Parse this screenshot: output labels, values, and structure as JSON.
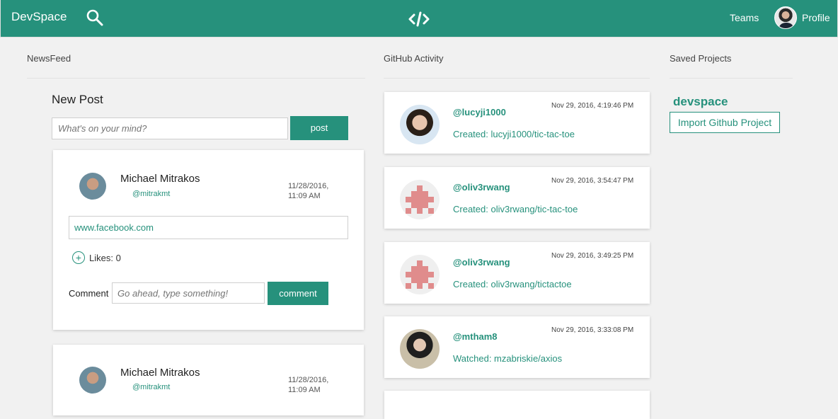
{
  "navbar": {
    "brand": "DevSpace",
    "teams": "Teams",
    "profile": "Profile",
    "icons": [
      "search-icon",
      "code-logo-icon",
      "avatar"
    ]
  },
  "columns": {
    "newsfeed": "NewsFeed",
    "github": "GitHub Activity",
    "saved": "Saved Projects"
  },
  "new_post": {
    "title": "New Post",
    "placeholder": "What's on your mind?",
    "button": "post"
  },
  "posts": [
    {
      "author": "Michael Mitrakos",
      "handle": "@mitrakmt",
      "date": "11/28/2016,",
      "time": "11:09 AM",
      "link": "www.facebook.com",
      "likes": "Likes: 0",
      "comment_label": "Comment",
      "comment_placeholder": "Go ahead, type something!",
      "comment_button": "comment"
    },
    {
      "author": "Michael Mitrakos",
      "handle": "@mitrakmt",
      "date": "11/28/2016,",
      "time": "11:09 AM"
    }
  ],
  "github_activity": [
    {
      "handle": "@lucyji1000",
      "time": "Nov 29, 2016, 4:19:46 PM",
      "action": "Created: lucyji1000/tic-tac-toe"
    },
    {
      "handle": "@oliv3rwang",
      "time": "Nov 29, 2016, 3:54:47 PM",
      "action": "Created: oliv3rwang/tic-tac-toe"
    },
    {
      "handle": "@oliv3rwang",
      "time": "Nov 29, 2016, 3:49:25 PM",
      "action": "Created: oliv3rwang/tictactoe"
    },
    {
      "handle": "@mtham8",
      "time": "Nov 29, 2016, 3:33:08 PM",
      "action": "Watched: mzabriskie/axios"
    }
  ],
  "saved_projects": {
    "name": "devspace",
    "import_button": "Import Github Project"
  },
  "colors": {
    "accent": "#26917c",
    "identicon": "#e08c8c"
  }
}
